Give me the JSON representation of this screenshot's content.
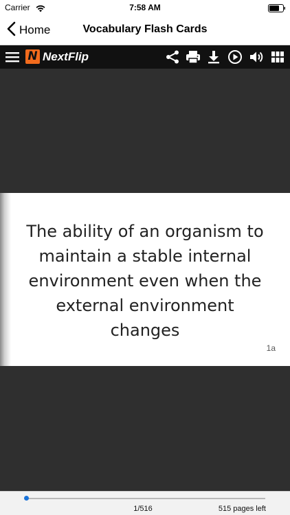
{
  "status_bar": {
    "carrier": "Carrier",
    "time": "7:58 AM"
  },
  "nav": {
    "back_label": "Home",
    "title": "Vocabulary Flash Cards"
  },
  "toolbar": {
    "logo_mark": "N",
    "logo_text": "NextFlip",
    "icons": [
      "menu-icon",
      "share-icon",
      "print-icon",
      "download-icon",
      "play-icon",
      "sound-icon",
      "grid-icon"
    ]
  },
  "card": {
    "lines": [
      "The ability of an organism to",
      "maintain a stable internal",
      "environment even when the",
      "external environment",
      "changes"
    ],
    "id": "1a"
  },
  "pager": {
    "page_count": "1/516",
    "pages_left": "515 pages left",
    "progress_fraction": 0.002
  },
  "colors": {
    "toolbar_bg": "#111111",
    "viewer_bg": "#2f2f2f",
    "logo_accent": "#f26b1d",
    "slider_thumb": "#1a73d9"
  }
}
